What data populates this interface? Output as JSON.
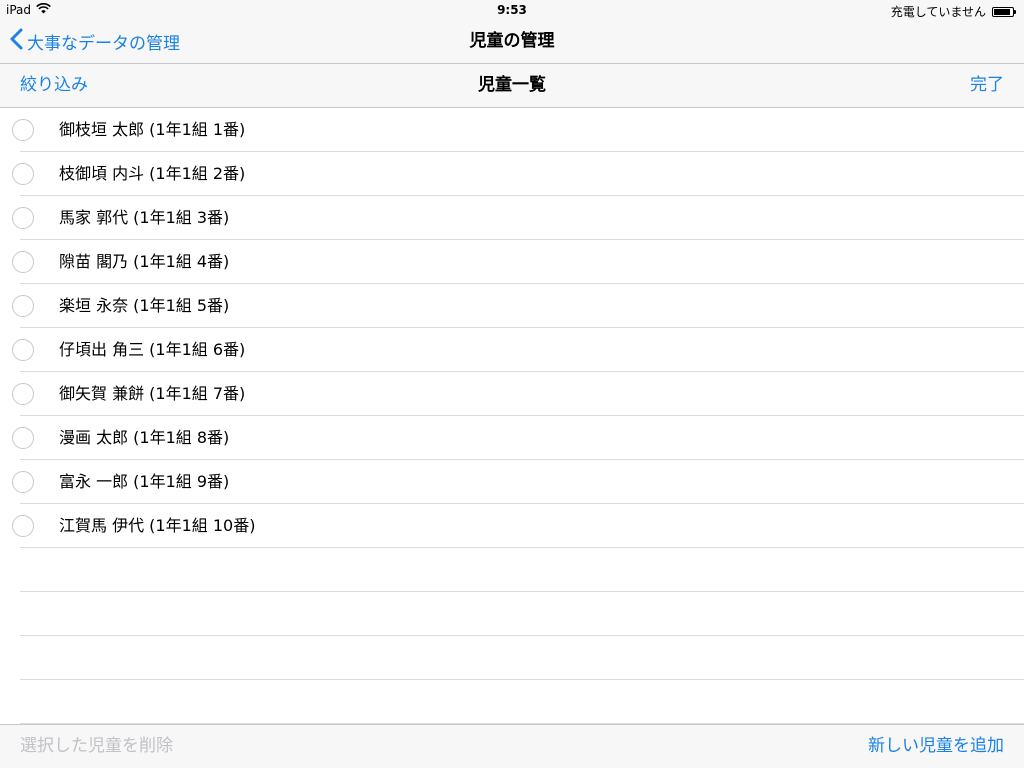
{
  "status_bar": {
    "device": "iPad",
    "time": "9:53",
    "charging": "充電していません",
    "icons": [
      "wifi-icon",
      "battery-icon"
    ],
    "battery_level": 0.9
  },
  "nav_bar": {
    "back_label": "大事なデータの管理",
    "title": "児童の管理",
    "back_icon": "chevron-left-icon"
  },
  "sub_bar": {
    "filter_label": "絞り込み",
    "title": "児童一覧",
    "done_label": "完了"
  },
  "students": [
    "御枝垣 太郎 (1年1組 1番)",
    "枝御頃 内斗 (1年1組 2番)",
    "馬家 郭代 (1年1組 3番)",
    "隙苗 閣乃 (1年1組 4番)",
    "楽垣 永奈 (1年1組 5番)",
    "仔頃出 角三 (1年1組 6番)",
    "御矢賀 兼餅 (1年1組 7番)",
    "漫画 太郎 (1年1組 8番)",
    "富永 一郎 (1年1組 9番)",
    "江賀馬 伊代 (1年1組 10番)"
  ],
  "bottom_bar": {
    "delete_label": "選択した児童を削除",
    "add_label": "新しい児童を追加"
  },
  "colors": {
    "accent": "#1a82e2",
    "disabled": "#c1c1c6",
    "bar_background": "#f7f7f7",
    "separator": "#dcdcdf"
  }
}
